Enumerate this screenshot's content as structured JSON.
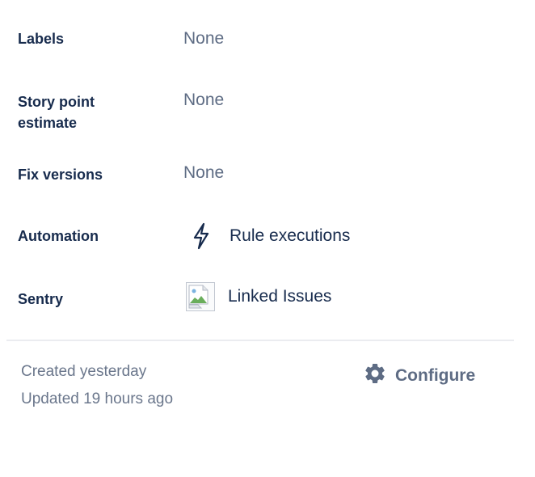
{
  "fields": {
    "labels": {
      "label": "Labels",
      "value": "None"
    },
    "story_points": {
      "label_line1": "Story point",
      "label_line2": "estimate",
      "value": "None"
    },
    "fix_versions": {
      "label": "Fix versions",
      "value": "None"
    },
    "automation": {
      "label": "Automation",
      "link_text": "Rule executions",
      "icon": "lightning-bolt-icon"
    },
    "sentry": {
      "label": "Sentry",
      "link_text": "Linked Issues",
      "icon": "broken-image-icon"
    }
  },
  "footer": {
    "created": "Created yesterday",
    "updated": "Updated 19 hours ago",
    "configure_label": "Configure",
    "configure_icon": "gear-icon"
  },
  "colors": {
    "label": "#172b4d",
    "muted": "#5e6c84",
    "meta": "#6b778c",
    "divider": "#ebecf0"
  }
}
